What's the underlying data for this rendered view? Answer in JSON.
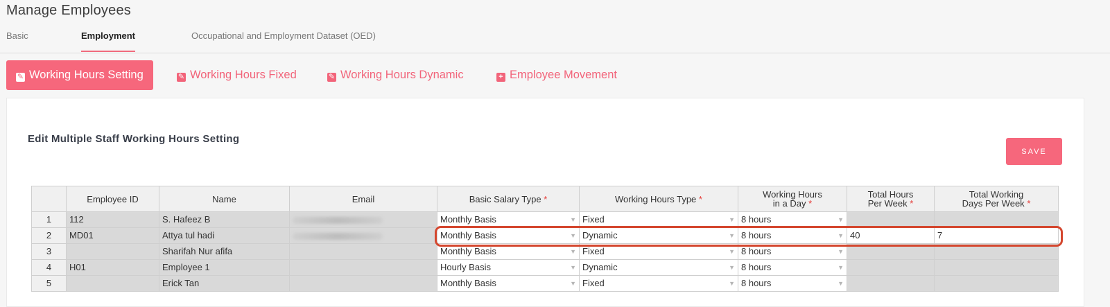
{
  "page": {
    "title": "Manage Employees"
  },
  "tabs": [
    {
      "label": "Basic",
      "active": false
    },
    {
      "label": "Employment",
      "active": true
    },
    {
      "label": "Occupational and Employment Dataset (OED)",
      "active": false
    }
  ],
  "subtabs": [
    {
      "label": "Working Hours Setting",
      "icon": "edit-icon",
      "active": true
    },
    {
      "label": "Working Hours Fixed",
      "icon": "edit-icon",
      "active": false
    },
    {
      "label": "Working Hours Dynamic",
      "icon": "edit-icon",
      "active": false
    },
    {
      "label": "Employee Movement",
      "icon": "plus-square-icon",
      "active": false
    }
  ],
  "card": {
    "title": "Edit Multiple Staff Working Hours Setting",
    "save_label": "SAVE"
  },
  "table": {
    "columns": [
      {
        "label": "",
        "required": false
      },
      {
        "label": "Employee ID",
        "required": false
      },
      {
        "label": "Name",
        "required": false
      },
      {
        "label": "Email",
        "required": false
      },
      {
        "label": "Basic Salary Type",
        "required": true
      },
      {
        "label": "Working Hours Type",
        "required": true
      },
      {
        "label": "Working Hours in a Day",
        "line1": "Working Hours",
        "line2": "in a Day",
        "required": true
      },
      {
        "label": "Total Hours Per Week",
        "line1": "Total Hours",
        "line2": "Per Week",
        "required": true
      },
      {
        "label": "Total Working Days Per Week",
        "line1": "Total Working",
        "line2": "Days Per Week",
        "required": true
      }
    ],
    "rows": [
      {
        "n": "1",
        "id": "112",
        "name": "S. Hafeez B",
        "email_blurred": true,
        "salary_type": "Monthly Basis",
        "hours_type": "Fixed",
        "hours_day": "8 hours",
        "hours_week": "",
        "days_week": ""
      },
      {
        "n": "2",
        "id": "MD01",
        "name": "Attya tul hadi",
        "email_blurred": true,
        "salary_type": "Monthly Basis",
        "hours_type": "Dynamic",
        "hours_day": "8 hours",
        "hours_week": "40",
        "days_week": "7"
      },
      {
        "n": "3",
        "id": "",
        "name": "Sharifah Nur afifa",
        "email_blurred": false,
        "salary_type": "Monthly Basis",
        "hours_type": "Fixed",
        "hours_day": "8 hours",
        "hours_week": "",
        "days_week": ""
      },
      {
        "n": "4",
        "id": "H01",
        "name": "Employee 1",
        "email_blurred": false,
        "salary_type": "Hourly Basis",
        "hours_type": "Dynamic",
        "hours_day": "8 hours",
        "hours_week": "",
        "days_week": ""
      },
      {
        "n": "5",
        "id": "",
        "name": "Erick Tan",
        "email_blurred": false,
        "salary_type": "Monthly Basis",
        "hours_type": "Fixed",
        "hours_day": "8 hours",
        "hours_week": "",
        "days_week": ""
      }
    ],
    "highlighted_row": "2"
  },
  "colors": {
    "accent": "#f6677c",
    "highlight_border": "#d4472f",
    "required_star": "#e53935"
  }
}
